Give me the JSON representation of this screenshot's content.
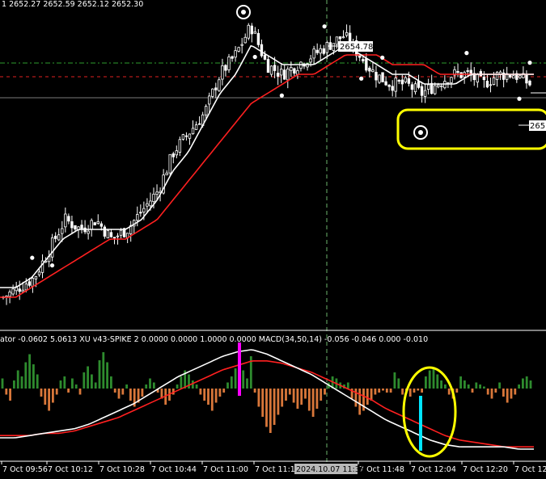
{
  "header": {
    "ohlc_text": "1  2652.27 2652.59 2652.12 2652.30"
  },
  "subwindow": {
    "indicator_text": "ator -0.0602 5.0613  XU  v43-SPIKE 2  0.0000  0.0000  1.0000  0.0000   MACD(34,50,14) -0.056 -0.046  0.000 -0.010"
  },
  "price_tags": {
    "upper": "2654.78",
    "right": "265"
  },
  "crosshair_time": "2024.10.07 11:38",
  "colors": {
    "background": "#000000",
    "candles": "#ffffff",
    "fast_ma": "#ffffff",
    "slow_ma": "#ff2020",
    "hist_pos": "#2e8b2e",
    "hist_neg": "#d9773a",
    "spike_magenta": "#ff00ff",
    "spike_cyan": "#00e5ff",
    "highlight": "#ffff00",
    "level_green": "#2e9b2e",
    "level_red": "#e02020"
  },
  "chart_data": [
    {
      "type": "candlestick",
      "title": "",
      "x_ticks": [
        "7 Oct 09:56",
        "7 Oct 10:12",
        "7 Oct 10:28",
        "7 Oct 10:44",
        "7 Oct 11:00",
        "7 Oct 11:16",
        "2024.10.07 11:38",
        "7 Oct 11:48",
        "7 Oct 12:04",
        "7 Oct 12:20",
        "7 Oct 12:"
      ],
      "close_path": [
        2628,
        2629,
        2630,
        2633,
        2636,
        2635,
        2636,
        2634,
        2635,
        2637,
        2639,
        2643,
        2645,
        2647,
        2651,
        2653,
        2656,
        2652,
        2651,
        2652,
        2653,
        2654,
        2655,
        2653,
        2651,
        2650,
        2650,
        2649,
        2650,
        2651,
        2651,
        2650,
        2651,
        2651,
        2650
      ],
      "fast_ma_path": [
        2629,
        2629,
        2630,
        2632,
        2634,
        2635,
        2635,
        2635,
        2635,
        2636,
        2638,
        2641,
        2643,
        2646,
        2649,
        2651,
        2654,
        2653,
        2652,
        2652,
        2652,
        2653,
        2654,
        2653,
        2652,
        2651,
        2651,
        2650,
        2650,
        2650,
        2651,
        2651,
        2651,
        2651,
        2651
      ],
      "slow_ma_path": [
        2628,
        2628,
        2629,
        2630,
        2631,
        2632,
        2633,
        2634,
        2634,
        2635,
        2636,
        2638,
        2640,
        2642,
        2644,
        2646,
        2648,
        2649,
        2650,
        2651,
        2651,
        2652,
        2653,
        2653,
        2653,
        2652,
        2652,
        2652,
        2651,
        2651,
        2651,
        2651,
        2651,
        2651,
        2651
      ],
      "levels": [
        {
          "name": "green-dashed-level",
          "value": 2655.6
        },
        {
          "name": "red-dashed-level",
          "value": 2654.0
        },
        {
          "name": "grey-level",
          "value": 2652.0
        }
      ]
    },
    {
      "type": "bar",
      "title": "MACD(34,50,14)",
      "values": [
        0.5,
        -0.3,
        -0.6,
        0.4,
        0.9,
        0.6,
        1.3,
        1.7,
        1.2,
        0.7,
        -0.4,
        -0.8,
        -1.1,
        -0.7,
        -0.3,
        0.4,
        0.6,
        -0.2,
        0.5,
        0.2,
        -0.3,
        0.8,
        1.1,
        0.7,
        0.3,
        1.4,
        1.8,
        1.3,
        0.6,
        -0.2,
        -0.5,
        -0.3,
        0.2,
        -0.6,
        -0.9,
        -0.7,
        -0.4,
        0.2,
        0.5,
        0.3,
        -0.2,
        -0.5,
        -0.8,
        -0.6,
        -0.3,
        0.2,
        0.6,
        0.9,
        0.7,
        0.4,
        0.2,
        -0.3,
        -0.6,
        -0.8,
        -1.1,
        -0.7,
        -0.4,
        -0.2,
        0.3,
        0.6,
        1.0,
        1.3,
        0.9,
        0.5,
        1.6,
        -0.2,
        -0.9,
        -1.4,
        -1.9,
        -2.2,
        -1.8,
        -1.3,
        -0.9,
        -0.6,
        -0.3,
        -0.7,
        -1.0,
        -0.8,
        -0.5,
        -1.1,
        -1.4,
        -1.0,
        -0.6,
        -0.3,
        0.3,
        0.6,
        0.5,
        0.3,
        0.2,
        0.3,
        -0.5,
        -0.9,
        -1.3,
        -1.1,
        -0.8,
        -0.6,
        -0.3,
        -0.2,
        -0.1,
        -0.2,
        -0.2,
        0.8,
        0.5,
        -0.3,
        -0.1,
        -0.4,
        -0.2,
        -0.1,
        -0.2,
        0.6,
        0.9,
        1.0,
        0.7,
        0.4,
        0.2,
        -0.3,
        -0.5,
        -0.2,
        0.6,
        0.4,
        0.2,
        -0.2,
        0.3,
        0.2,
        0.1,
        -0.3,
        -0.5,
        -0.2,
        0.3,
        -0.4,
        -0.7,
        -0.5,
        -0.3,
        0.2,
        0.5,
        0.6,
        0.4
      ],
      "signal_white": [
        -1.5,
        -1.5,
        -1.4,
        -1.3,
        -1.2,
        -1.1,
        -0.9,
        -0.6,
        -0.3,
        0.0,
        0.4,
        0.8,
        1.2,
        1.5,
        1.8,
        2.1,
        2.3,
        2.4,
        2.2,
        1.9,
        1.6,
        1.3,
        0.9,
        0.5,
        0.1,
        -0.3,
        -0.7,
        -1.0,
        -1.3,
        -1.6,
        -1.8,
        -1.9,
        -1.9,
        -1.9,
        -1.9,
        -2.0,
        -2.0
      ],
      "signal_red": [
        -1.4,
        -1.4,
        -1.4,
        -1.3,
        -1.3,
        -1.2,
        -1.0,
        -0.8,
        -0.6,
        -0.3,
        0.0,
        0.3,
        0.6,
        0.9,
        1.2,
        1.5,
        1.7,
        1.9,
        1.9,
        1.8,
        1.6,
        1.4,
        1.1,
        0.8,
        0.5,
        0.2,
        -0.2,
        -0.5,
        -0.8,
        -1.1,
        -1.4,
        -1.6,
        -1.7,
        -1.8,
        -1.9,
        -1.9,
        -1.9
      ]
    }
  ]
}
